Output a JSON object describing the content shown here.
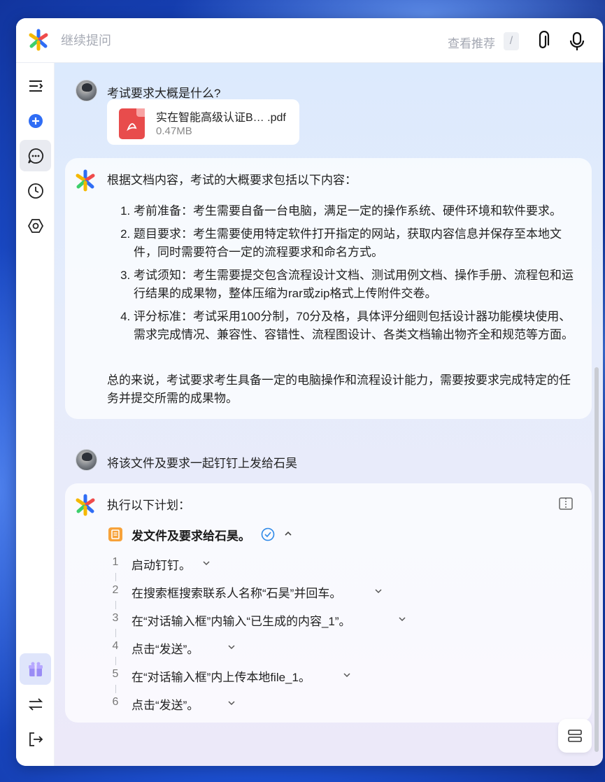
{
  "topbar": {
    "input_placeholder": "继续提问",
    "suggest_label": "查看推荐",
    "shortcut_key": "/"
  },
  "conversation": {
    "q1": {
      "text": "考试要求大概是什么?",
      "attachment": {
        "name": "实在智能高级认证B… .pdf",
        "size": "0.47MB"
      }
    },
    "a1": {
      "intro": "根据文档内容，考试的大概要求包括以下内容：",
      "items": [
        "考前准备：考生需要自备一台电脑，满足一定的操作系统、硬件环境和软件要求。",
        "题目要求：考生需要使用特定软件打开指定的网站，获取内容信息并保存至本地文件，同时需要符合一定的流程要求和命名方式。",
        "考试须知：考生需要提交包含流程设计文档、测试用例文档、操作手册、流程包和运行结果的成果物，整体压缩为rar或zip格式上传附件交卷。",
        "评分标准：考试采用100分制，70分及格，具体评分细则包括设计器功能模块使用、需求完成情况、兼容性、容错性、流程图设计、各类文档输出物齐全和规范等方面。"
      ],
      "summary": "总的来说，考试要求考生具备一定的电脑操作和流程设计能力，需要按要求完成特定的任务并提交所需的成果物。"
    },
    "q2": {
      "text": "将该文件及要求一起钉钉上发给石昊"
    },
    "a2": {
      "intro": "执行以下计划：",
      "task_title": "发文件及要求给石昊。",
      "steps": [
        {
          "num": "1",
          "label": "启动钉钉。"
        },
        {
          "num": "2",
          "label": "在搜索框搜索联系人名称“石昊”并回车。"
        },
        {
          "num": "3",
          "label": "在“对话输入框”内输入“已生成的内容_1”。"
        },
        {
          "num": "4",
          "label": "点击“发送”。"
        },
        {
          "num": "5",
          "label": "在“对话输入框”内上传本地file_1。"
        },
        {
          "num": "6",
          "label": "点击“发送”。"
        }
      ]
    }
  },
  "colors": {
    "accent": "#2f6df5",
    "pdf": "#e84c4c",
    "task": "#f7a23a",
    "check": "#2f8ae8"
  }
}
